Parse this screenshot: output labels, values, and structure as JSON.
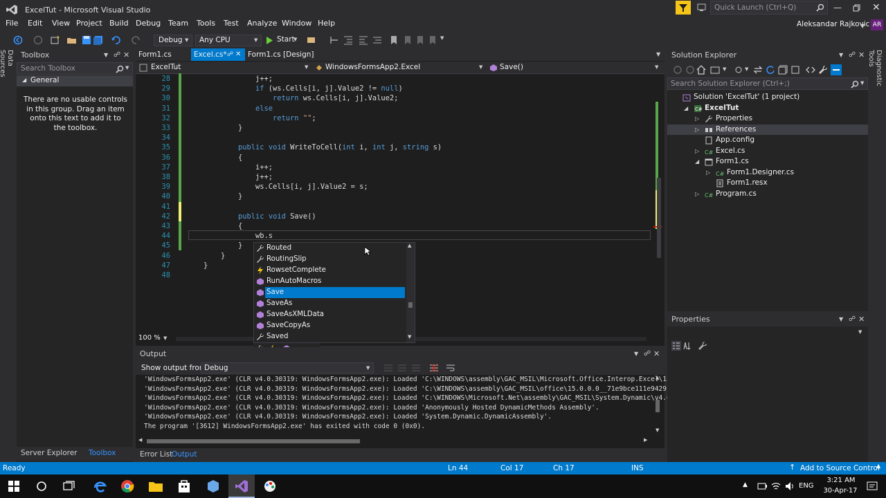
{
  "window": {
    "title": "ExcelTut - Microsoft Visual Studio",
    "user": "Aleksandar Rajkovic",
    "user_initials": "AR",
    "quick_launch_placeholder": "Quick Launch (Ctrl+Q)"
  },
  "menu": [
    "File",
    "Edit",
    "View",
    "Project",
    "Build",
    "Debug",
    "Team",
    "Tools",
    "Test",
    "Analyze",
    "Window",
    "Help"
  ],
  "toolbar": {
    "config": "Debug",
    "platform": "Any CPU",
    "start": "Start"
  },
  "left_strip": {
    "label": "Data Sources"
  },
  "right_strip": {
    "label": "Diagnostic Tools"
  },
  "toolbox": {
    "title": "Toolbox",
    "search_placeholder": "Search Toolbox",
    "group": "General",
    "empty_message": "There are no usable controls in this group. Drag an item onto this text to add it to the toolbox.",
    "bottom_tabs": [
      "Server Explorer",
      "Toolbox"
    ]
  },
  "editor": {
    "tabs": [
      {
        "label": "Form1.cs",
        "active": false
      },
      {
        "label": "Excel.cs*",
        "active": true
      },
      {
        "label": "Form1.cs [Design]",
        "active": false
      }
    ],
    "nav": {
      "project": "ExcelTut",
      "class": "WindowsFormsApp2.Excel",
      "member": "Save()"
    },
    "zoom": "100 %",
    "lines": [
      {
        "n": "28",
        "indent": 6,
        "tokens": [
          [
            "plain",
            "j++;"
          ]
        ]
      },
      {
        "n": "29",
        "indent": 6,
        "tokens": [
          [
            "kw",
            "if"
          ],
          [
            "plain",
            " (ws.Cells[i, j].Value2 != "
          ],
          [
            "kw",
            "null"
          ],
          [
            "plain",
            ")"
          ]
        ]
      },
      {
        "n": "30",
        "indent": 8,
        "tokens": [
          [
            "kw",
            "return"
          ],
          [
            "plain",
            " ws.Cells[i, j].Value2;"
          ]
        ]
      },
      {
        "n": "31",
        "indent": 6,
        "tokens": [
          [
            "kw",
            "else"
          ]
        ]
      },
      {
        "n": "32",
        "indent": 8,
        "tokens": [
          [
            "kw",
            "return"
          ],
          [
            "plain",
            " "
          ],
          [
            "str",
            "\"\""
          ],
          [
            "plain",
            ";"
          ]
        ]
      },
      {
        "n": "33",
        "indent": 4,
        "tokens": [
          [
            "plain",
            "}"
          ]
        ]
      },
      {
        "n": "34",
        "indent": 0,
        "tokens": []
      },
      {
        "n": "35",
        "indent": 4,
        "tokens": [
          [
            "kw",
            "public"
          ],
          [
            "plain",
            " "
          ],
          [
            "kw",
            "void"
          ],
          [
            "plain",
            " WriteToCell("
          ],
          [
            "kw",
            "int"
          ],
          [
            "plain",
            " i, "
          ],
          [
            "kw",
            "int"
          ],
          [
            "plain",
            " j, "
          ],
          [
            "kw",
            "string"
          ],
          [
            "plain",
            " s)"
          ]
        ]
      },
      {
        "n": "36",
        "indent": 4,
        "tokens": [
          [
            "plain",
            "{"
          ]
        ]
      },
      {
        "n": "37",
        "indent": 6,
        "tokens": [
          [
            "plain",
            "i++;"
          ]
        ]
      },
      {
        "n": "38",
        "indent": 6,
        "tokens": [
          [
            "plain",
            "j++;"
          ]
        ]
      },
      {
        "n": "39",
        "indent": 6,
        "tokens": [
          [
            "plain",
            "ws.Cells[i, j].Value2 = s;"
          ]
        ]
      },
      {
        "n": "40",
        "indent": 4,
        "tokens": [
          [
            "plain",
            "}"
          ]
        ]
      },
      {
        "n": "41",
        "indent": 0,
        "tokens": []
      },
      {
        "n": "42",
        "indent": 4,
        "tokens": [
          [
            "kw",
            "public"
          ],
          [
            "plain",
            " "
          ],
          [
            "kw",
            "void"
          ],
          [
            "plain",
            " Save()"
          ]
        ]
      },
      {
        "n": "43",
        "indent": 4,
        "tokens": [
          [
            "plain",
            "{"
          ]
        ]
      },
      {
        "n": "44",
        "indent": 6,
        "tokens": [
          [
            "plain",
            "wb.s"
          ]
        ]
      },
      {
        "n": "45",
        "indent": 4,
        "tokens": [
          [
            "plain",
            "}"
          ]
        ]
      },
      {
        "n": "46",
        "indent": 2,
        "tokens": [
          [
            "plain",
            "}"
          ]
        ]
      },
      {
        "n": "47",
        "indent": 0,
        "tokens": [
          [
            "plain",
            "}"
          ]
        ]
      },
      {
        "n": "48",
        "indent": 0,
        "tokens": []
      }
    ],
    "autocomplete": [
      {
        "label": "Routed",
        "icon": "wrench-icon",
        "selected": false
      },
      {
        "label": "RoutingSlip",
        "icon": "wrench-icon",
        "selected": false
      },
      {
        "label": "RowsetComplete",
        "icon": "event-icon",
        "selected": false
      },
      {
        "label": "RunAutoMacros",
        "icon": "method-icon",
        "selected": false
      },
      {
        "label": "Save",
        "icon": "method-icon",
        "selected": true
      },
      {
        "label": "SaveAs",
        "icon": "method-icon",
        "selected": false
      },
      {
        "label": "SaveAsXMLData",
        "icon": "method-icon",
        "selected": false
      },
      {
        "label": "SaveCopyAs",
        "icon": "method-icon",
        "selected": false
      },
      {
        "label": "Saved",
        "icon": "wrench-icon",
        "selected": false
      }
    ]
  },
  "output": {
    "title": "Output",
    "show_from_label": "Show output from:",
    "show_from_value": "Debug",
    "lines": [
      "'WindowsFormsApp2.exe' (CLR v4.0.30319: WindowsFormsApp2.exe): Loaded 'C:\\WINDOWS\\assembly\\GAC_MSIL\\Microsoft.Office.Interop.Excel\\15.0.0.",
      "'WindowsFormsApp2.exe' (CLR v4.0.30319: WindowsFormsApp2.exe): Loaded 'C:\\WINDOWS\\assembly\\GAC_MSIL\\office\\15.0.0.0__71e9bce111e9429c\\offi",
      "'WindowsFormsApp2.exe' (CLR v4.0.30319: WindowsFormsApp2.exe): Loaded 'C:\\WINDOWS\\Microsoft.Net\\assembly\\GAC_MSIL\\System.Dynamic\\v4.0_4.0.",
      "'WindowsFormsApp2.exe' (CLR v4.0.30319: WindowsFormsApp2.exe): Loaded 'Anonymously Hosted DynamicMethods Assembly'.",
      "'WindowsFormsApp2.exe' (CLR v4.0.30319: WindowsFormsApp2.exe): Loaded 'System.Dynamic.DynamicAssembly'.",
      "The program '[3612] WindowsFormsApp2.exe' has exited with code 0 (0x0)."
    ],
    "bottom_tabs": [
      "Error List",
      "Output"
    ]
  },
  "solution_explorer": {
    "title": "Solution Explorer",
    "search_placeholder": "Search Solution Explorer (Ctrl+;)",
    "items": [
      {
        "label": "Solution 'ExcelTut' (1 project)",
        "depth": 0,
        "expander": "",
        "icon": "solution-icon",
        "bold": false,
        "selected": false
      },
      {
        "label": "ExcelTut",
        "depth": 1,
        "expander": "open",
        "icon": "csharp-project-icon",
        "bold": true,
        "selected": false
      },
      {
        "label": "Properties",
        "depth": 2,
        "expander": "closed",
        "icon": "wrench-icon",
        "bold": false,
        "selected": false
      },
      {
        "label": "References",
        "depth": 2,
        "expander": "closed",
        "icon": "references-icon",
        "bold": false,
        "selected": true
      },
      {
        "label": "App.config",
        "depth": 2,
        "expander": "",
        "icon": "config-file-icon",
        "bold": false,
        "selected": false
      },
      {
        "label": "Excel.cs",
        "depth": 2,
        "expander": "closed",
        "icon": "csharp-file-icon",
        "bold": false,
        "selected": false
      },
      {
        "label": "Form1.cs",
        "depth": 2,
        "expander": "open",
        "icon": "form-icon",
        "bold": false,
        "selected": false
      },
      {
        "label": "Form1.Designer.cs",
        "depth": 3,
        "expander": "closed",
        "icon": "csharp-file-icon",
        "bold": false,
        "selected": false
      },
      {
        "label": "Form1.resx",
        "depth": 3,
        "expander": "",
        "icon": "resx-file-icon",
        "bold": false,
        "selected": false
      },
      {
        "label": "Program.cs",
        "depth": 2,
        "expander": "closed",
        "icon": "csharp-file-icon",
        "bold": false,
        "selected": false
      }
    ]
  },
  "properties": {
    "title": "Properties"
  },
  "status": {
    "state": "Ready",
    "ln": "Ln 44",
    "col": "Col 17",
    "ch": "Ch 17",
    "mode": "INS",
    "source_control": "Add to Source Control"
  },
  "taskbar": {
    "lang": "ENG",
    "time": "3:21 AM",
    "date": "30-Apr-17"
  },
  "colors": {
    "accent": "#007acc",
    "selection": "#007acc",
    "editor_bg": "#1e1e1e",
    "keyword": "#569cd6",
    "string": "#d69d85",
    "line_number": "#2b91af"
  }
}
